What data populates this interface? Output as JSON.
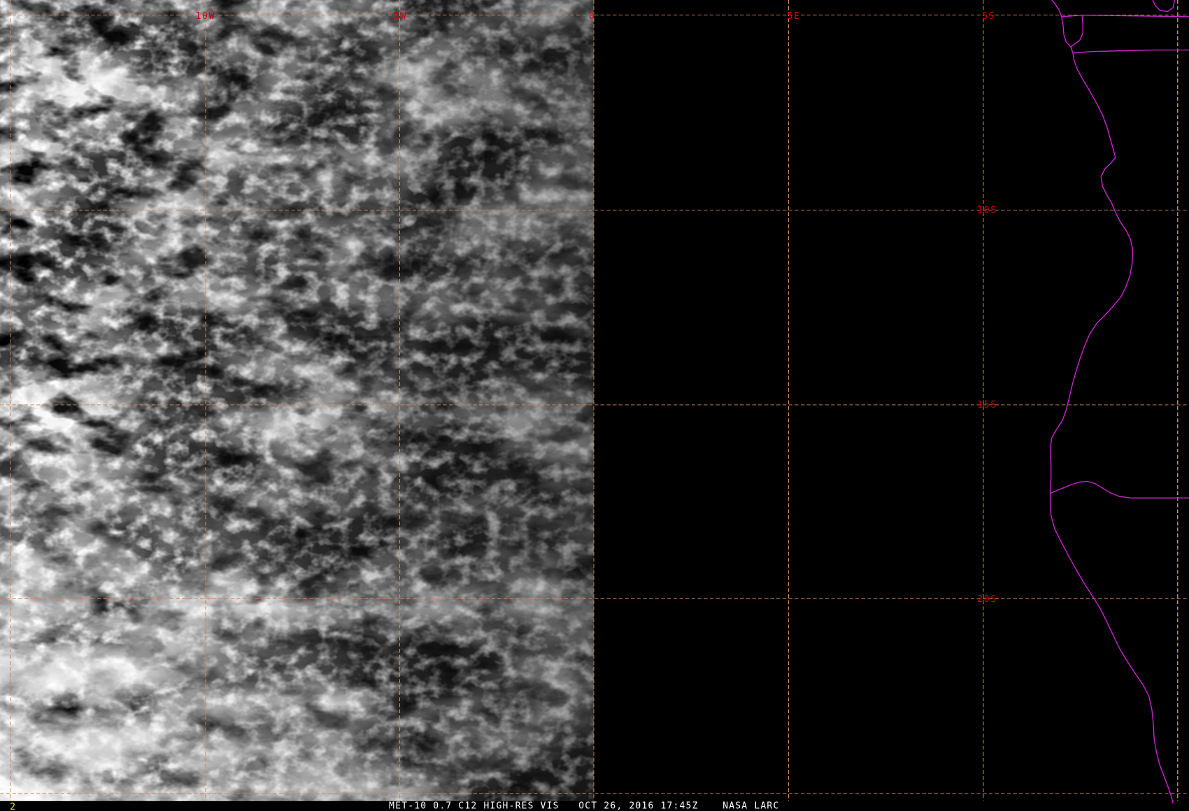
{
  "viewer": {
    "frame_number": "2",
    "product": "MET-10 0.7 C12 HIGH-RES VIS",
    "timestamp": "OCT 26, 2016 17:45Z",
    "source": "NASA LARC"
  },
  "grid": {
    "longitude_labels": [
      "10W",
      "5W",
      "0",
      "5E"
    ],
    "latitude_labels": [
      "5S",
      "10S",
      "15S",
      "20S"
    ]
  },
  "colors": {
    "background": "#000000",
    "grid_line": "#c8875a",
    "grid_label": "#d60000",
    "coastline": "#cc22cc",
    "status_text": "#ffffff",
    "frame_number": "#e8e800"
  }
}
